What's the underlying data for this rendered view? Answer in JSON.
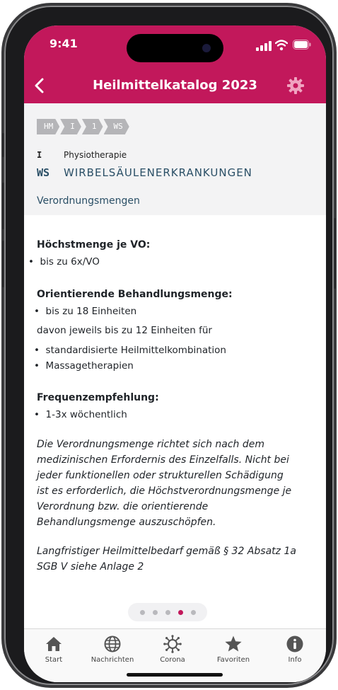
{
  "status": {
    "time": "9:41"
  },
  "header": {
    "title": "Heilmittelkatalog 2023"
  },
  "breadcrumb": [
    "HM",
    "I",
    "1",
    "WS"
  ],
  "category": {
    "code": "I",
    "label": "Physiotherapie"
  },
  "diagnosis": {
    "code": "WS",
    "label": "WIRBELSÄULENERKRANKUNGEN"
  },
  "tab": {
    "label": "Verordnungsmengen"
  },
  "content": {
    "max_heading": "Höchstmenge je VO:",
    "max_item": "bis zu 6x/VO",
    "orient_heading": "Orientierende Behandlungsmenge:",
    "orient_item": "bis zu 18 Einheiten",
    "orient_sub": "davon jeweils bis zu 12 Einheiten für",
    "orient_list": [
      "standardisierte Heilmittelkombination",
      "Massagetherapien"
    ],
    "freq_heading": "Frequenzempfehlung:",
    "freq_item": "1-3x wöchentlich",
    "note_lines": [
      "Die Verordnungsmenge richtet sich nach dem",
      "medizinischen Erfordernis des Einzelfalls. Nicht bei",
      "jeder funktionellen oder strukturellen Schädigung",
      "ist es erforderlich, die Höchstverordnungsmenge je",
      "Verordnung bzw. die orientierende",
      "Behandlungsmenge auszuschöpfen."
    ],
    "note2_lines": [
      "Langfristiger Heilmittelbedarf gemäß § 32 Absatz 1a",
      "SGB V siehe Anlage 2"
    ]
  },
  "pager": {
    "count": 5,
    "active_index": 3
  },
  "tabbar": [
    {
      "label": "Start",
      "icon": "house-icon"
    },
    {
      "label": "Nachrichten",
      "icon": "globe-icon"
    },
    {
      "label": "Corona",
      "icon": "virus-icon"
    },
    {
      "label": "Favoriten",
      "icon": "star-icon"
    },
    {
      "label": "Info",
      "icon": "info-icon"
    }
  ],
  "colors": {
    "brand": "#c2185b",
    "accent_text": "#2a4f66"
  }
}
